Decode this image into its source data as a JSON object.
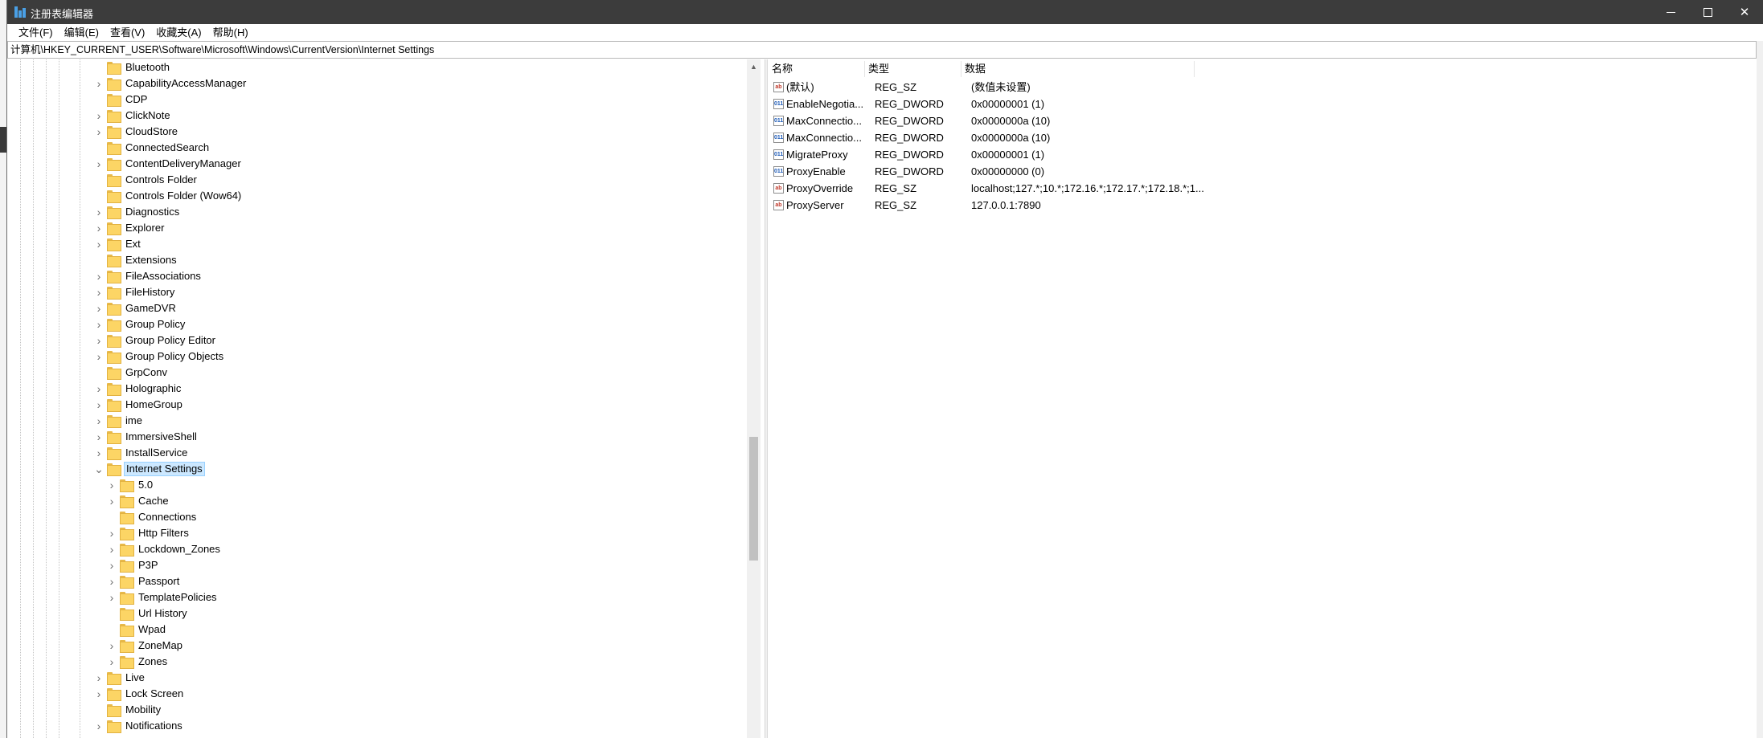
{
  "window": {
    "title": "注册表编辑器",
    "icon": "registry-editor-icon",
    "controls": [
      "minimize-icon",
      "maximize-icon",
      "close-icon"
    ]
  },
  "menu": [
    "文件(F)",
    "编辑(E)",
    "查看(V)",
    "收藏夹(A)",
    "帮助(H)"
  ],
  "address": "计算机\\HKEY_CURRENT_USER\\Software\\Microsoft\\Windows\\CurrentVersion\\Internet Settings",
  "tree": {
    "selected": "Internet Settings",
    "items": [
      {
        "label": "Bluetooth",
        "level": 1,
        "expander": false
      },
      {
        "label": "CapabilityAccessManager",
        "level": 1,
        "expander": true
      },
      {
        "label": "CDP",
        "level": 1,
        "expander": false
      },
      {
        "label": "ClickNote",
        "level": 1,
        "expander": true
      },
      {
        "label": "CloudStore",
        "level": 1,
        "expander": true
      },
      {
        "label": "ConnectedSearch",
        "level": 1,
        "expander": false
      },
      {
        "label": "ContentDeliveryManager",
        "level": 1,
        "expander": true
      },
      {
        "label": "Controls Folder",
        "level": 1,
        "expander": false
      },
      {
        "label": "Controls Folder (Wow64)",
        "level": 1,
        "expander": false
      },
      {
        "label": "Diagnostics",
        "level": 1,
        "expander": true
      },
      {
        "label": "Explorer",
        "level": 1,
        "expander": true
      },
      {
        "label": "Ext",
        "level": 1,
        "expander": true
      },
      {
        "label": "Extensions",
        "level": 1,
        "expander": false
      },
      {
        "label": "FileAssociations",
        "level": 1,
        "expander": true
      },
      {
        "label": "FileHistory",
        "level": 1,
        "expander": true
      },
      {
        "label": "GameDVR",
        "level": 1,
        "expander": true
      },
      {
        "label": "Group Policy",
        "level": 1,
        "expander": true
      },
      {
        "label": "Group Policy Editor",
        "level": 1,
        "expander": true
      },
      {
        "label": "Group Policy Objects",
        "level": 1,
        "expander": true
      },
      {
        "label": "GrpConv",
        "level": 1,
        "expander": false
      },
      {
        "label": "Holographic",
        "level": 1,
        "expander": true
      },
      {
        "label": "HomeGroup",
        "level": 1,
        "expander": true
      },
      {
        "label": "ime",
        "level": 1,
        "expander": true
      },
      {
        "label": "ImmersiveShell",
        "level": 1,
        "expander": true
      },
      {
        "label": "InstallService",
        "level": 1,
        "expander": true
      },
      {
        "label": "Internet Settings",
        "level": 1,
        "expander": true,
        "expanded": true
      },
      {
        "label": "5.0",
        "level": 2,
        "expander": true
      },
      {
        "label": "Cache",
        "level": 2,
        "expander": true
      },
      {
        "label": "Connections",
        "level": 2,
        "expander": false
      },
      {
        "label": "Http Filters",
        "level": 2,
        "expander": true
      },
      {
        "label": "Lockdown_Zones",
        "level": 2,
        "expander": true
      },
      {
        "label": "P3P",
        "level": 2,
        "expander": true
      },
      {
        "label": "Passport",
        "level": 2,
        "expander": true
      },
      {
        "label": "TemplatePolicies",
        "level": 2,
        "expander": true
      },
      {
        "label": "Url History",
        "level": 2,
        "expander": false
      },
      {
        "label": "Wpad",
        "level": 2,
        "expander": false
      },
      {
        "label": "ZoneMap",
        "level": 2,
        "expander": true
      },
      {
        "label": "Zones",
        "level": 2,
        "expander": true
      },
      {
        "label": "Live",
        "level": 1,
        "expander": true
      },
      {
        "label": "Lock Screen",
        "level": 1,
        "expander": true
      },
      {
        "label": "Mobility",
        "level": 1,
        "expander": false
      },
      {
        "label": "Notifications",
        "level": 1,
        "expander": true
      }
    ]
  },
  "values": {
    "columns": [
      "名称",
      "类型",
      "数据"
    ],
    "rows": [
      {
        "icon": "string-value-icon",
        "kind": "sz",
        "name": "(默认)",
        "type": "REG_SZ",
        "data": "(数值未设置)"
      },
      {
        "icon": "dword-value-icon",
        "kind": "dw",
        "name": "EnableNegotia...",
        "type": "REG_DWORD",
        "data": "0x00000001 (1)"
      },
      {
        "icon": "dword-value-icon",
        "kind": "dw",
        "name": "MaxConnectio...",
        "type": "REG_DWORD",
        "data": "0x0000000a (10)"
      },
      {
        "icon": "dword-value-icon",
        "kind": "dw",
        "name": "MaxConnectio...",
        "type": "REG_DWORD",
        "data": "0x0000000a (10)"
      },
      {
        "icon": "dword-value-icon",
        "kind": "dw",
        "name": "MigrateProxy",
        "type": "REG_DWORD",
        "data": "0x00000001 (1)"
      },
      {
        "icon": "dword-value-icon",
        "kind": "dw",
        "name": "ProxyEnable",
        "type": "REG_DWORD",
        "data": "0x00000000 (0)"
      },
      {
        "icon": "string-value-icon",
        "kind": "sz",
        "name": "ProxyOverride",
        "type": "REG_SZ",
        "data": "localhost;127.*;10.*;172.16.*;172.17.*;172.18.*;1..."
      },
      {
        "icon": "string-value-icon",
        "kind": "sz",
        "name": "ProxyServer",
        "type": "REG_SZ",
        "data": "127.0.0.1:7890"
      }
    ]
  },
  "colors": {
    "titlebar": "#3c3c3c",
    "selection": "#cce8ff",
    "folder": "#fcd565"
  }
}
